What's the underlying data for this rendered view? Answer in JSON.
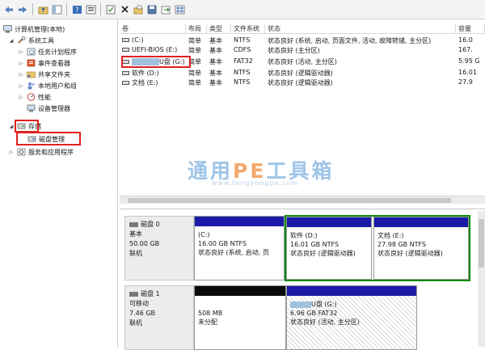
{
  "tree": {
    "root": "计算机管理(本地)",
    "system_tools": "系统工具",
    "task_scheduler": "任务计划程序",
    "event_viewer": "事件查看器",
    "shared_folders": "共享文件夹",
    "local_users": "本地用户和组",
    "performance": "性能",
    "device_manager": "设备管理器",
    "storage": "存储",
    "disk_management": "磁盘管理",
    "services": "服务和应用程序"
  },
  "list": {
    "headers": [
      "卷",
      "布局",
      "类型",
      "文件系统",
      "状态",
      "容量"
    ],
    "rows": [
      {
        "vol": "(C:)",
        "layout": "简单",
        "type": "基本",
        "fs": "NTFS",
        "status": "状态良好 (系统, 启动, 页面文件, 活动, 故障转储, 主分区)",
        "cap": "16.0"
      },
      {
        "vol": "UEFI-BIOS (E:)",
        "layout": "简单",
        "type": "基本",
        "fs": "CDFS",
        "status": "状态良好 (主分区)",
        "cap": "167."
      },
      {
        "vol": "U盘 (G:)",
        "layout": "简单",
        "type": "基本",
        "fs": "FAT32",
        "status": "状态良好 (活动, 主分区)",
        "cap": "5.95 G"
      },
      {
        "vol": "软件 (D:)",
        "layout": "简单",
        "type": "基本",
        "fs": "NTFS",
        "status": "状态良好 (逻辑驱动器)",
        "cap": "16.01"
      },
      {
        "vol": "文档 (E:)",
        "layout": "简单",
        "type": "基本",
        "fs": "NTFS",
        "status": "状态良好 (逻辑驱动器)",
        "cap": "27.9"
      }
    ]
  },
  "watermark": {
    "main_left": "通用",
    "main_pe": "PE",
    "main_right": "工具箱",
    "sub": "www.tongyongpe.com"
  },
  "disk0": {
    "name": "磁盘 0",
    "type": "基本",
    "size": "50.00 GB",
    "state": "联机",
    "partitions": [
      {
        "name": "(C:)",
        "size": "16.00 GB NTFS",
        "status": "状态良好 (系统, 启动, 页"
      },
      {
        "name": "软件 (D:)",
        "size": "16.01 GB NTFS",
        "status": "状态良好 (逻辑驱动器)"
      },
      {
        "name": "文档 (E:)",
        "size": "27.98 GB NTFS",
        "status": "状态良好 (逻辑驱动器)"
      }
    ]
  },
  "disk1": {
    "name": "磁盘 1",
    "type": "可移动",
    "size": "7.46 GB",
    "state": "联机",
    "partitions": [
      {
        "name": "",
        "size": "508 MB",
        "status": "未分配"
      },
      {
        "name": "U盘 (G:)",
        "size": "6.96 GB FAT32",
        "status": "状态良好 (活动, 主分区)"
      }
    ]
  },
  "colors": {
    "primary_bar": "#1a1aa6",
    "unallocated_bar": "#0a0a0a",
    "highlight_red": "#e02020",
    "selected_green": "#0a8a0a"
  }
}
